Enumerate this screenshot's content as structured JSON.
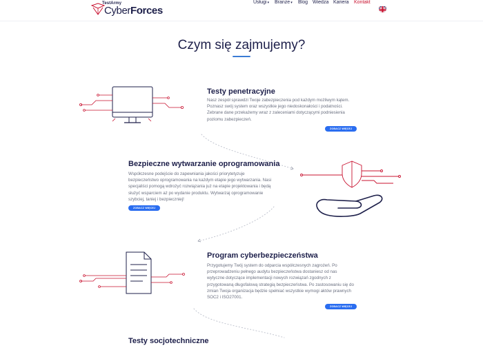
{
  "logo": {
    "small": "TestArmy",
    "big_light": "Cyber",
    "big_bold": "Forces"
  },
  "nav": [
    {
      "label": "Usługi",
      "has_caret": true
    },
    {
      "label": "Branże",
      "has_caret": true
    },
    {
      "label": "Blog",
      "has_caret": false
    },
    {
      "label": "Wiedza",
      "has_caret": false
    },
    {
      "label": "Kariera",
      "has_caret": false
    },
    {
      "label": "Kontakt",
      "has_caret": false,
      "active": true
    }
  ],
  "nav_caret": "▾",
  "language_icon": "uk-flag-icon",
  "heading": "Czym się zajmujemy?",
  "sections": [
    {
      "title": "Testy penetracyjne",
      "text": "Nasz zespół sprawdzi Twoje zabezpieczenia pod każdym możliwym kątem. Poznasz swój system oraz wszystkie jego niedoskonałości i podatności. Zebrane dane przekażemy wraz z zaleceniami dotyczącymi podniesienia poziomu zabezpieczeń.",
      "button": "ZOBACZ WIĘCEJ",
      "icon": "monitor-icon"
    },
    {
      "title": "Bezpieczne wytwarzanie oprogramowania",
      "text": "Współczesne podejście do zapewniania jakości priorytetyzuje bezpieczeństwo oprogramowania na każdym etapie jego wytwarzania. Nasi specjaliści pomogą wdrożyć rozwiązania już na etapie projektowania i będą służyć wsparciem aż po wydanie produktu. Wytwarzaj oprogramowanie szybciej, taniej i bezpieczniej!",
      "button": "ZOBACZ WIĘCEJ",
      "icon": "shield-hand-icon"
    },
    {
      "title": "Program cyberbezpieczeństwa",
      "text": "Przygotujemy Twój system do odparcia współczesnych zagrożeń. Po przeprowadzeniu pełnego audytu bezpieczeństwa dostaniesz od nas wytyczne dotyczące implementacji nowych rozwiązań zgodnych z przygotowaną długofalową strategią bezpieczeństwa. Po zastosowaniu się do zmian Twoja organizacja będzie spełniać wszystkie wymogi aktów prawnych SOC2 i ISO27001.",
      "button": "ZOBACZ WIĘCEJ",
      "icon": "document-icon"
    },
    {
      "title": "Testy socjotechniczne"
    }
  ],
  "colors": {
    "navy": "#1d1f4a",
    "accent_red": "#c8102e",
    "button_blue": "#2a6df0",
    "text_gray": "#6b7080"
  }
}
